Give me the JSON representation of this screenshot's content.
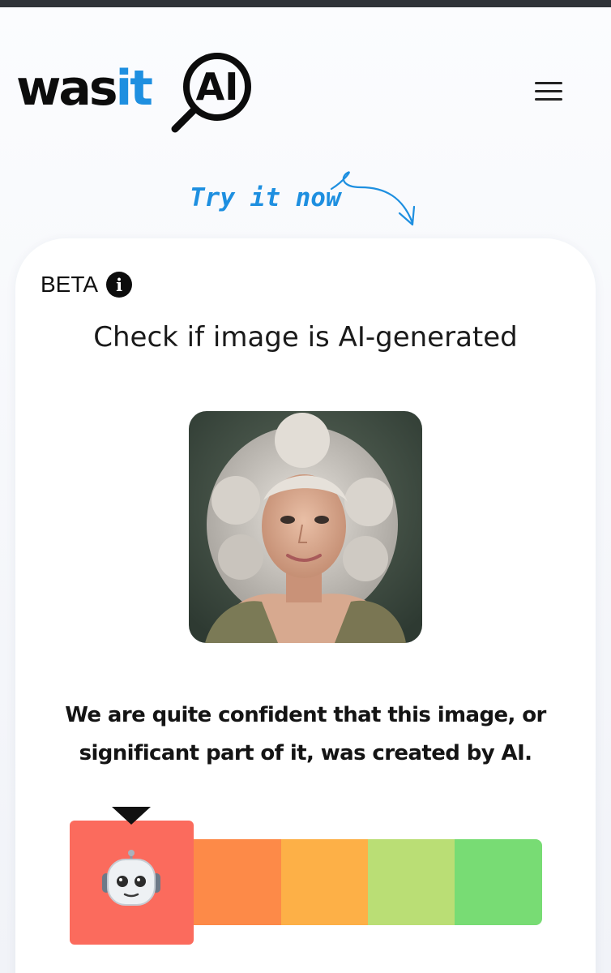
{
  "header": {
    "logo": {
      "part1": "was",
      "part2": "it",
      "part3": "AI"
    },
    "menu_icon": "hamburger-menu-icon"
  },
  "promo": {
    "try_now": "Try it now"
  },
  "card": {
    "beta_label": "BETA",
    "info_icon": "info-icon",
    "title": "Check if image is AI-generated",
    "result_text": "We are quite confident that this image, or significant part of it, was created by AI."
  },
  "scale": {
    "active_level": 1,
    "levels": 5,
    "colors": [
      "#fb6b5d",
      "#fd8a48",
      "#fdb047",
      "#bade75",
      "#78dc74"
    ],
    "indicator_icon": "robot-face-icon"
  }
}
